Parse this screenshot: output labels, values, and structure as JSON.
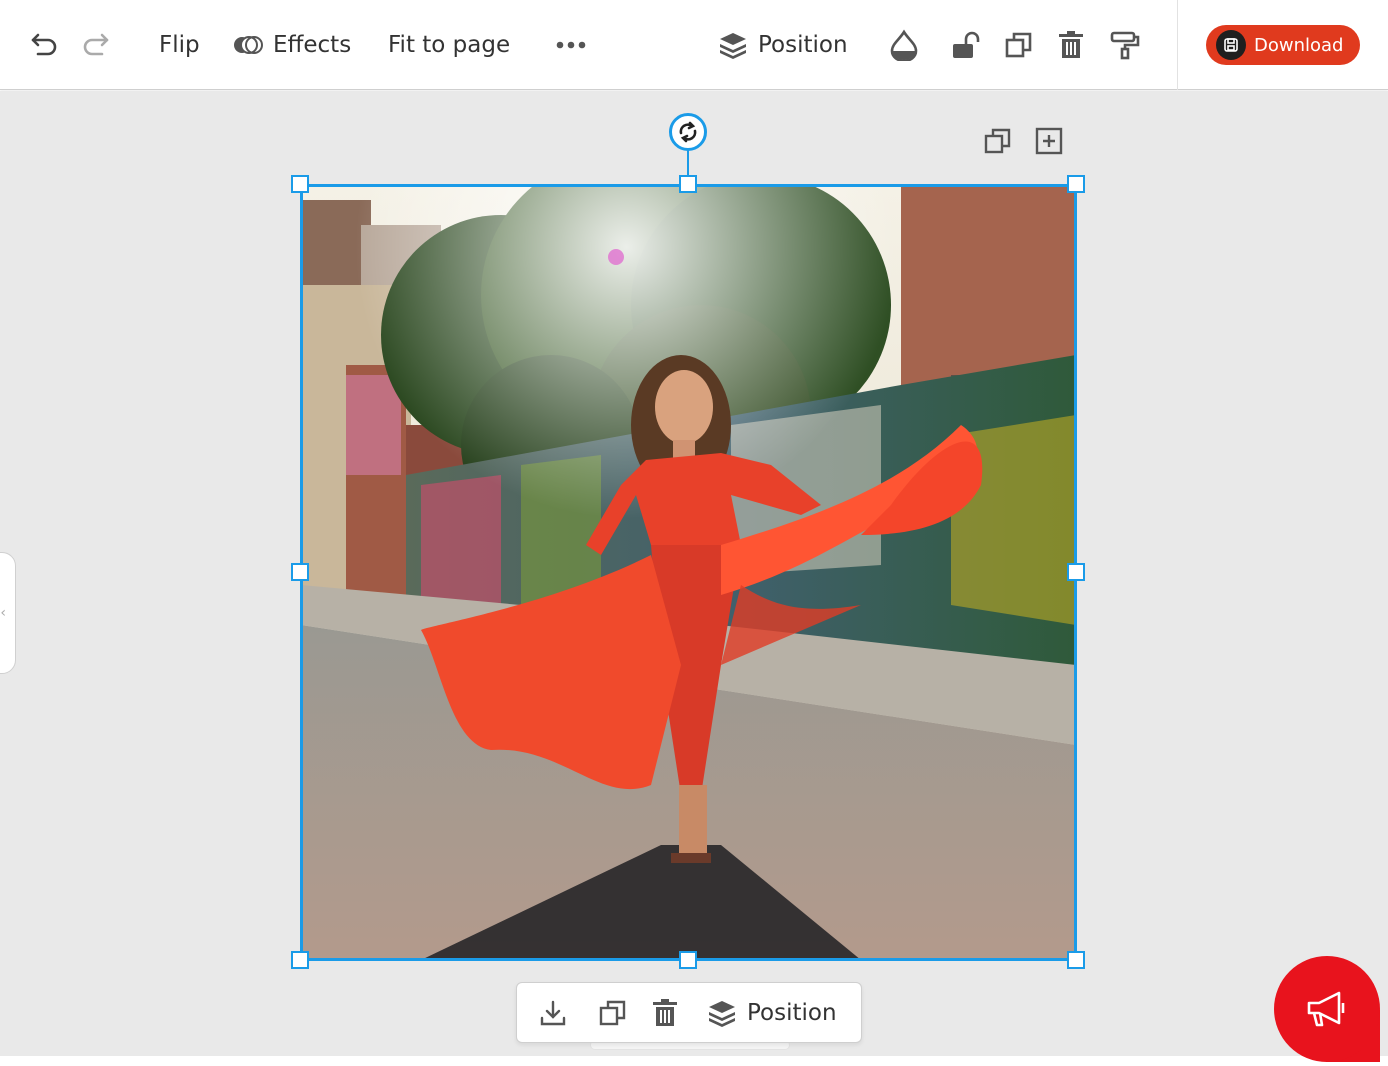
{
  "toolbar": {
    "undo_icon": "undo-icon",
    "redo_icon": "redo-icon",
    "flip_label": "Flip",
    "effects_label": "Effects",
    "fit_label": "Fit to page",
    "more_icon": "more-horizontal-icon",
    "position_label": "Position",
    "icons": [
      "transparency-icon",
      "unlock-icon",
      "duplicate-icon",
      "trash-icon",
      "paint-roller-icon"
    ],
    "download_label": "Download",
    "accent_color": "#e03a1e"
  },
  "canvas": {
    "background": "#e9e9e9",
    "selection_color": "#1a9be8",
    "float_icons": [
      "duplicate-icon",
      "add-page-icon"
    ],
    "left_tab_glyph": "‹"
  },
  "context_bar": {
    "icons": [
      "download-icon",
      "duplicate-icon",
      "trash-icon",
      "layers-icon"
    ],
    "position_label": "Position"
  },
  "fab": {
    "icon": "megaphone-icon",
    "color": "#e8131d"
  }
}
